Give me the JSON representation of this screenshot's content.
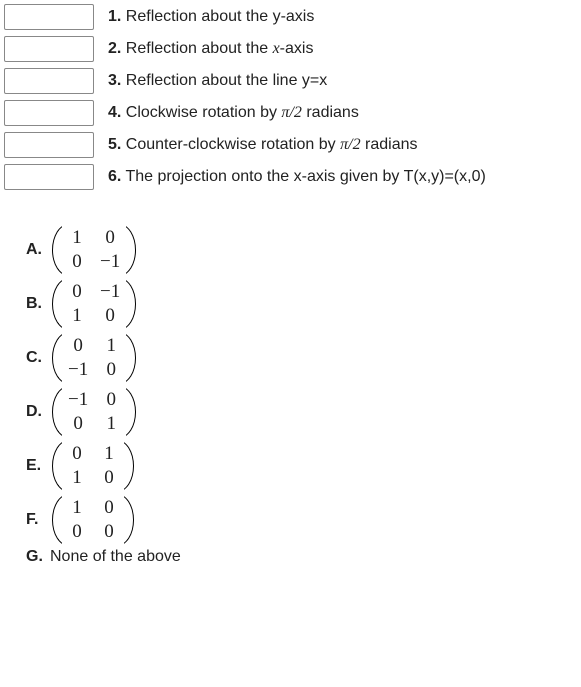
{
  "prompts": [
    {
      "num": "1.",
      "text_pre": "Reflection about the y-axis",
      "text_post": ""
    },
    {
      "num": "2.",
      "text_pre": "Reflection about the ",
      "ital": "x",
      "text_post": "-axis"
    },
    {
      "num": "3.",
      "text_pre": "Reflection about the line y=x",
      "text_post": ""
    },
    {
      "num": "4.",
      "text_pre": "Clockwise rotation by ",
      "frac": "π/2",
      "text_post": " radians"
    },
    {
      "num": "5.",
      "text_pre": "Counter-clockwise rotation by ",
      "frac": "π/2",
      "text_post": " radians"
    },
    {
      "num": "6.",
      "text_pre": "The projection onto the x-axis given by T(x,y)=(x,0)",
      "text_post": ""
    }
  ],
  "options": [
    {
      "label": "A.",
      "m": [
        "1",
        "0",
        "0",
        "−1"
      ]
    },
    {
      "label": "B.",
      "m": [
        "0",
        "−1",
        "1",
        "0"
      ]
    },
    {
      "label": "C.",
      "m": [
        "0",
        "1",
        "−1",
        "0"
      ]
    },
    {
      "label": "D.",
      "m": [
        "−1",
        "0",
        "0",
        "1"
      ]
    },
    {
      "label": "E.",
      "m": [
        "0",
        "1",
        "1",
        "0"
      ]
    },
    {
      "label": "F.",
      "m": [
        "1",
        "0",
        "0",
        "0"
      ]
    }
  ],
  "none_label": "G.",
  "none_text": "None of the above"
}
